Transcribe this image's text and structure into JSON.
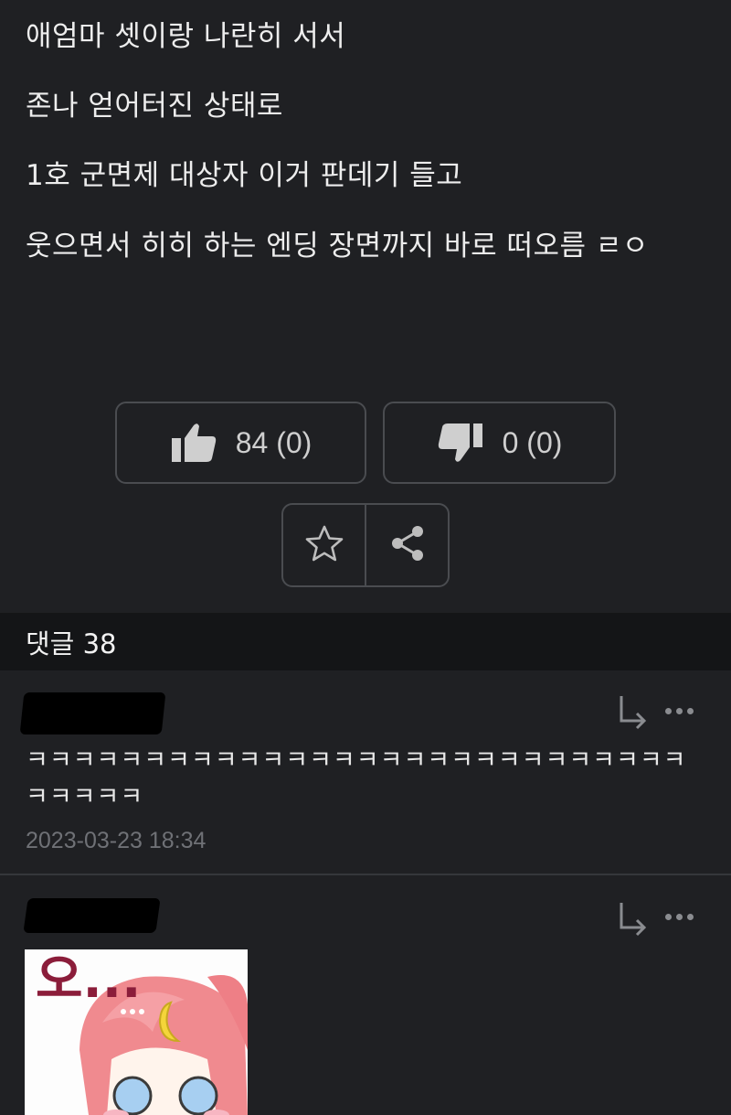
{
  "post": {
    "lines": [
      "애엄마 셋이랑 나란히 서서",
      "존나 얻어터진 상태로",
      "1호 군면제 대상자 이거 판데기 들고",
      "웃으면서 히히 하는 엔딩 장면까지 바로 떠오름 ㄹㅇ"
    ]
  },
  "votes": {
    "up_label": "84 (0)",
    "down_label": "0 (0)"
  },
  "actions": {
    "bookmark_icon": "star-icon",
    "share_icon": "share-icon"
  },
  "comments_header": {
    "label": "댓글 38"
  },
  "comments": [
    {
      "author": "",
      "text": "ㅋㅋㅋㅋㅋㅋㅋㅋㅋㅋㅋㅋㅋㅋㅋㅋㅋㅋㅋㅋㅋㅋㅋㅋㅋㅋㅋㅋㅋㅋㅋㅋㅋ",
      "date": "2023-03-23 18:34"
    },
    {
      "author": "",
      "sticker_text": "오..."
    }
  ],
  "colors": {
    "background": "#1f2023",
    "header_bg": "#141517",
    "border": "#4a4c50",
    "muted": "#6f7176"
  }
}
